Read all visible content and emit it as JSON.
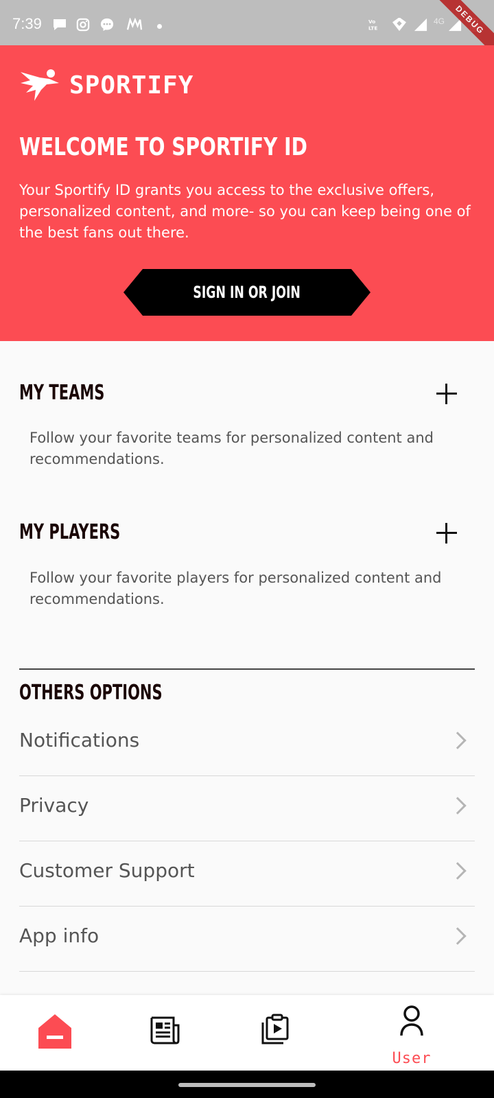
{
  "status_bar": {
    "time": "7:39",
    "network": "4G",
    "volte": "Vo LTE",
    "debug_banner": "DEBUG",
    "icons": [
      "chat-bubble-icon",
      "instagram-icon",
      "messenger-icon",
      "myntra-icon",
      "dot-icon",
      "volte-icon",
      "hotspot-icon",
      "signal-icon",
      "signal-4g-icon",
      "battery-icon"
    ]
  },
  "colors": {
    "brand": "#fc4c53",
    "button": "#000000",
    "heading": "#1a0505",
    "muted_text": "#555555"
  },
  "hero": {
    "logo_text": "SPORTIFY",
    "title": "WELCOME TO SPORTIFY ID",
    "description": "Your Sportify ID grants you access to the exclusive offers, personalized content, and more- so you can keep being one of the best fans out there.",
    "cta_label": "SIGN IN OR JOIN"
  },
  "sections": {
    "teams": {
      "title": "MY TEAMS",
      "description": "Follow your favorite teams for personalized content and recommendations."
    },
    "players": {
      "title": "MY PLAYERS",
      "description": "Follow your favorite players for personalized content and recommendations."
    }
  },
  "options": {
    "title": "OTHERS OPTIONS",
    "items": [
      {
        "label": "Notifications"
      },
      {
        "label": "Privacy"
      },
      {
        "label": "Customer Support"
      },
      {
        "label": "App info"
      }
    ]
  },
  "bottom_nav": {
    "items": [
      {
        "icon": "home-icon",
        "label": ""
      },
      {
        "icon": "news-icon",
        "label": ""
      },
      {
        "icon": "video-library-icon",
        "label": ""
      },
      {
        "icon": "user-icon",
        "label": "User"
      }
    ],
    "active_index": 3
  }
}
